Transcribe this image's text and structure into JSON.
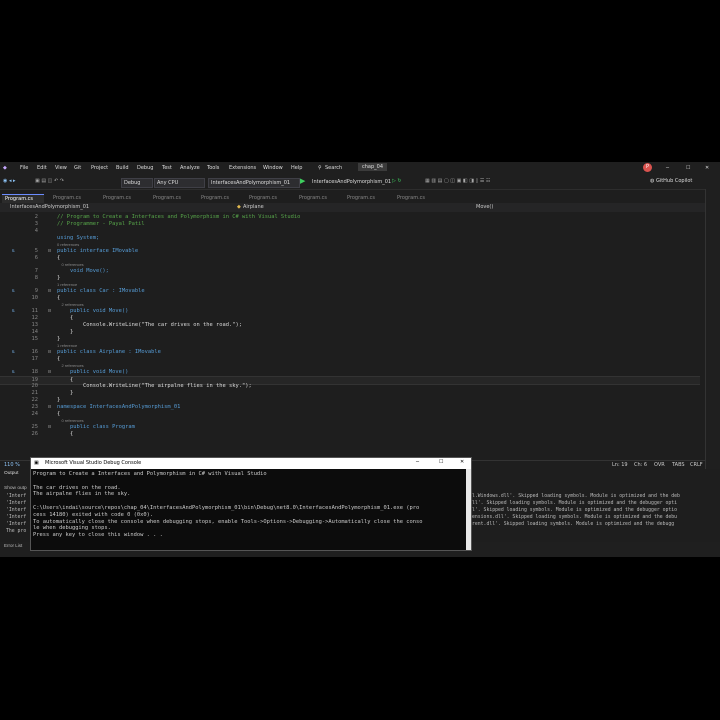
{
  "menu": [
    "File",
    "Edit",
    "View",
    "Git",
    "Project",
    "Build",
    "Debug",
    "Test",
    "Analyze",
    "Tools",
    "Extensions",
    "Window",
    "Help"
  ],
  "search_label": "Search",
  "solution_name": "chap_04",
  "toolbar": {
    "config": "Debug",
    "platform": "Any CPU",
    "project": "InterfacesAndPolymorphism_01",
    "run_target": "InterfacesAndPolymorphism_01",
    "copilot": "GitHub Copilot"
  },
  "tabs": [
    "Program.cs",
    "Program.cs",
    "Program.cs",
    "Program.cs",
    "Program.cs",
    "Program.cs",
    "Program.cs",
    "Program.cs"
  ],
  "navbar": {
    "project": "InterfacesAndPolymorphism_01",
    "class": "Airplane",
    "member": "Move()"
  },
  "code_lines": [
    {
      "n": "2",
      "t": "// Program to Create a Interfaces and Polymorphism in C# with Visual Studio",
      "c": "cm"
    },
    {
      "n": "3",
      "t": "// Programmer - Payal Patil",
      "c": "cm"
    },
    {
      "n": "4",
      "t": "",
      "c": "id"
    },
    {
      "n": "",
      "t": "using System;",
      "c": "kw",
      "ref": false
    },
    {
      "n": "",
      "t": "0 references",
      "c": "ref",
      "ref": true
    },
    {
      "n": "5",
      "t": "public interface IMovable",
      "c": "kw",
      "ico": true,
      "fold": true
    },
    {
      "n": "6",
      "t": "{",
      "c": "id"
    },
    {
      "n": "",
      "t": "    0 references",
      "c": "ref",
      "ref": true
    },
    {
      "n": "7",
      "t": "    void Move();",
      "c": "kw"
    },
    {
      "n": "8",
      "t": "}",
      "c": "id"
    },
    {
      "n": "",
      "t": "1 reference",
      "c": "ref",
      "ref": true
    },
    {
      "n": "9",
      "t": "public class Car : IMovable",
      "c": "kw",
      "ico": true,
      "fold": true
    },
    {
      "n": "10",
      "t": "{",
      "c": "id"
    },
    {
      "n": "",
      "t": "    2 references",
      "c": "ref",
      "ref": true
    },
    {
      "n": "11",
      "t": "    public void Move()",
      "c": "kw",
      "ico": true,
      "fold": true
    },
    {
      "n": "12",
      "t": "    {",
      "c": "id"
    },
    {
      "n": "13",
      "t": "        Console.WriteLine(\"The car drives on the road.\");",
      "c": "id"
    },
    {
      "n": "14",
      "t": "    }",
      "c": "id"
    },
    {
      "n": "15",
      "t": "}",
      "c": "id"
    },
    {
      "n": "",
      "t": "1 reference",
      "c": "ref",
      "ref": true
    },
    {
      "n": "16",
      "t": "public class Airplane : IMovable",
      "c": "kw",
      "ico": true,
      "fold": true
    },
    {
      "n": "17",
      "t": "{",
      "c": "id"
    },
    {
      "n": "",
      "t": "    2 references",
      "c": "ref",
      "ref": true
    },
    {
      "n": "18",
      "t": "    public void Move()",
      "c": "kw",
      "ico": true,
      "fold": true
    },
    {
      "n": "19",
      "t": "    {",
      "c": "id",
      "hl": true
    },
    {
      "n": "20",
      "t": "        Console.WriteLine(\"The airpalne flies in the sky.\");",
      "c": "id"
    },
    {
      "n": "21",
      "t": "    }",
      "c": "id"
    },
    {
      "n": "22",
      "t": "}",
      "c": "id"
    },
    {
      "n": "23",
      "t": "namespace InterfacesAndPolymorphism_01",
      "c": "kw",
      "fold": true
    },
    {
      "n": "24",
      "t": "{",
      "c": "id"
    },
    {
      "n": "",
      "t": "    0 references",
      "c": "ref",
      "ref": true
    },
    {
      "n": "25",
      "t": "    public class Program",
      "c": "kw",
      "fold": true
    },
    {
      "n": "26",
      "t": "    {",
      "c": "id"
    }
  ],
  "status": {
    "ln": "Ln: 19",
    "ch": "Ch: 6",
    "mode1": "OVR",
    "mode2": "TABS",
    "enc": "CRLF"
  },
  "output": {
    "title": "Output",
    "show_output": "Show outp",
    "left_lines": [
      "'Interf",
      "'Interf",
      "'Interf",
      "'Interf",
      "'Interf",
      "The pro"
    ],
    "right_lines": [
      "l.Windows.dll'. Skipped loading symbols. Module is optimized and the deb",
      "ll'. Skipped loading symbols. Module is optimized and the debugger opti",
      "l'. Skipped loading symbols. Module is optimized and the debugger optio",
      "ensions.dll'. Skipped loading symbols. Module is optimized and the debu",
      "rent.dll'. Skipped loading symbols. Module is optimized and the debugg"
    ]
  },
  "bottom_tab": "Error List",
  "console": {
    "title": "Microsoft Visual Studio Debug Console",
    "lines": [
      "Program to Create a Interfaces and Polymorphism in C# with Visual Studio",
      "",
      "The car drives on the road.",
      "The airpalne flies in the sky.",
      "",
      "C:\\Users\\indai\\source\\repos\\chap_04\\InterfacesAndPolymorphism_01\\bin\\Debug\\net8.0\\InterfacesAndPolymorphism_01.exe (pro",
      "cess 14180) exited with code 0 (0x0).",
      "To automatically close the console when debugging stops, enable Tools->Options->Debugging->Automatically close the conso",
      "le when debugging stops.",
      "Press any key to close this window . . ."
    ]
  }
}
